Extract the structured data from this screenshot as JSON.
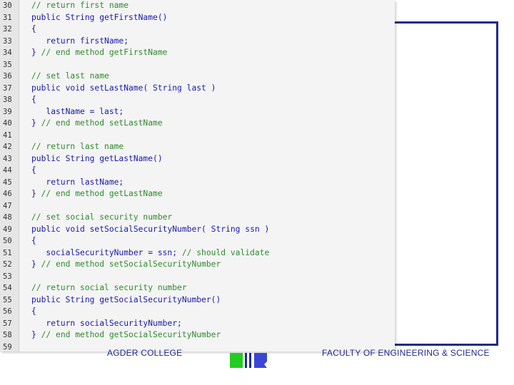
{
  "code": {
    "lines": [
      {
        "num": "30",
        "tokens": [
          {
            "t": "// return first name",
            "k": "comment"
          }
        ]
      },
      {
        "num": "31",
        "tokens": [
          {
            "t": "public ",
            "k": "keyword"
          },
          {
            "t": "String getFirstName()",
            "k": "plain"
          }
        ]
      },
      {
        "num": "32",
        "tokens": [
          {
            "t": "{",
            "k": "plain"
          }
        ]
      },
      {
        "num": "33",
        "tokens": [
          {
            "t": "   ",
            "k": "plain"
          },
          {
            "t": "return ",
            "k": "keyword"
          },
          {
            "t": "firstName;",
            "k": "plain"
          }
        ]
      },
      {
        "num": "34",
        "tokens": [
          {
            "t": "} ",
            "k": "plain"
          },
          {
            "t": "// end method getFirstName",
            "k": "comment"
          }
        ]
      },
      {
        "num": "35",
        "tokens": []
      },
      {
        "num": "36",
        "tokens": [
          {
            "t": "// set last name",
            "k": "comment"
          }
        ]
      },
      {
        "num": "37",
        "tokens": [
          {
            "t": "public void ",
            "k": "keyword"
          },
          {
            "t": "setLastName( String last )",
            "k": "plain"
          }
        ]
      },
      {
        "num": "38",
        "tokens": [
          {
            "t": "{",
            "k": "plain"
          }
        ]
      },
      {
        "num": "39",
        "tokens": [
          {
            "t": "   lastName = last;",
            "k": "plain"
          }
        ]
      },
      {
        "num": "40",
        "tokens": [
          {
            "t": "} ",
            "k": "plain"
          },
          {
            "t": "// end method setLastName",
            "k": "comment"
          }
        ]
      },
      {
        "num": "41",
        "tokens": []
      },
      {
        "num": "42",
        "tokens": [
          {
            "t": "// return last name",
            "k": "comment"
          }
        ]
      },
      {
        "num": "43",
        "tokens": [
          {
            "t": "public ",
            "k": "keyword"
          },
          {
            "t": "String getLastName()",
            "k": "plain"
          }
        ]
      },
      {
        "num": "44",
        "tokens": [
          {
            "t": "{",
            "k": "plain"
          }
        ]
      },
      {
        "num": "45",
        "tokens": [
          {
            "t": "   ",
            "k": "plain"
          },
          {
            "t": "return ",
            "k": "keyword"
          },
          {
            "t": "lastName;",
            "k": "plain"
          }
        ]
      },
      {
        "num": "46",
        "tokens": [
          {
            "t": "} ",
            "k": "plain"
          },
          {
            "t": "// end method getLastName",
            "k": "comment"
          }
        ]
      },
      {
        "num": "47",
        "tokens": []
      },
      {
        "num": "48",
        "tokens": [
          {
            "t": "// set social security number",
            "k": "comment"
          }
        ]
      },
      {
        "num": "49",
        "tokens": [
          {
            "t": "public void ",
            "k": "keyword"
          },
          {
            "t": "setSocialSecurityNumber( String ssn )",
            "k": "plain"
          }
        ]
      },
      {
        "num": "50",
        "tokens": [
          {
            "t": "{",
            "k": "plain"
          }
        ]
      },
      {
        "num": "51",
        "tokens": [
          {
            "t": "   socialSecurityNumber = ssn; ",
            "k": "plain"
          },
          {
            "t": "// should validate",
            "k": "comment"
          }
        ]
      },
      {
        "num": "52",
        "tokens": [
          {
            "t": "} ",
            "k": "plain"
          },
          {
            "t": "// end method setSocialSecurityNumber",
            "k": "comment"
          }
        ]
      },
      {
        "num": "53",
        "tokens": []
      },
      {
        "num": "54",
        "tokens": [
          {
            "t": "// return social security number",
            "k": "comment"
          }
        ]
      },
      {
        "num": "55",
        "tokens": [
          {
            "t": "public ",
            "k": "keyword"
          },
          {
            "t": "String getSocialSecurityNumber()",
            "k": "plain"
          }
        ]
      },
      {
        "num": "56",
        "tokens": [
          {
            "t": "{",
            "k": "plain"
          }
        ]
      },
      {
        "num": "57",
        "tokens": [
          {
            "t": "   ",
            "k": "plain"
          },
          {
            "t": "return ",
            "k": "keyword"
          },
          {
            "t": "socialSecurityNumber;",
            "k": "plain"
          }
        ]
      },
      {
        "num": "58",
        "tokens": [
          {
            "t": "} ",
            "k": "plain"
          },
          {
            "t": "// end method getSocialSecurityNumber",
            "k": "comment"
          }
        ]
      },
      {
        "num": "59",
        "tokens": []
      }
    ]
  },
  "footer": {
    "left_text": "AGDER COLLEGE",
    "right_text": "FACULTY OF ENGINEERING & SCIENCE",
    "logo_icon": "agder-college-logo-icon"
  },
  "colors": {
    "comment": "#2e8b2e",
    "keyword": "#1a1aa6",
    "frame": "#1f2a8c",
    "logo_green": "#22cc22",
    "logo_blue": "#3a46d6"
  }
}
